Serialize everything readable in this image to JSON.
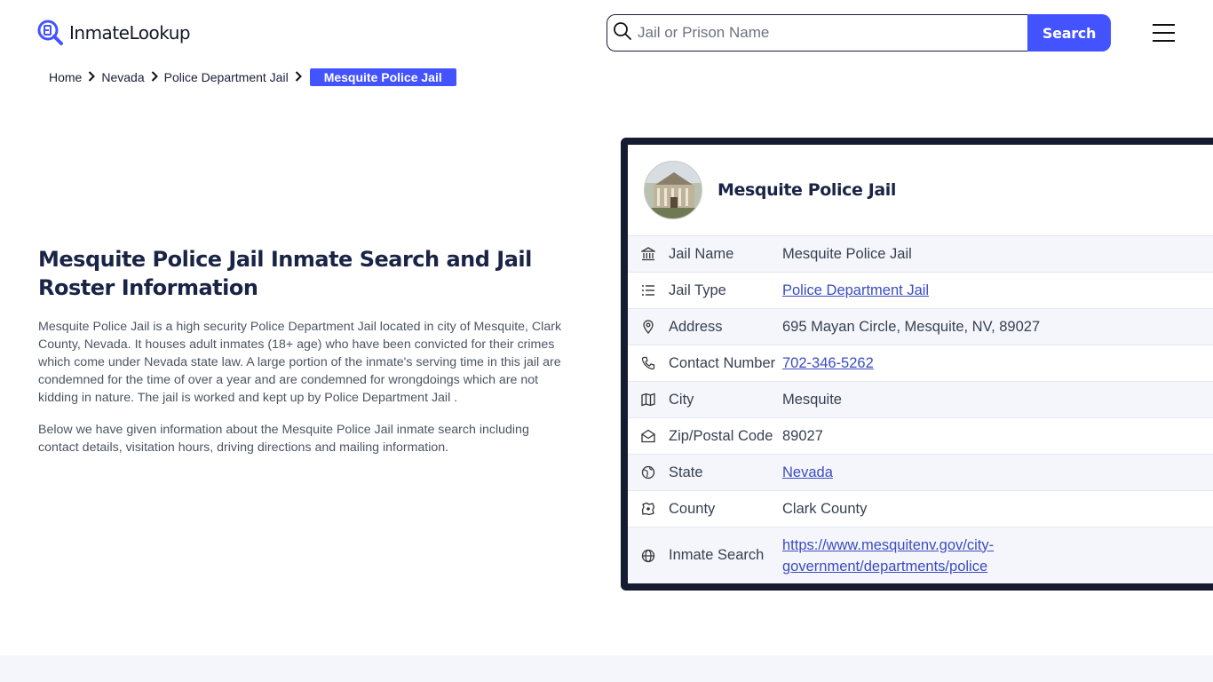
{
  "header": {
    "logo_text": "InmateLookup",
    "search_placeholder": "Jail or Prison Name",
    "search_button": "Search"
  },
  "breadcrumb": {
    "items": [
      "Home",
      "Nevada",
      "Police Department Jail"
    ],
    "active": "Mesquite Police Jail"
  },
  "intro": {
    "title": "Mesquite Police Jail Inmate Search and Jail Roster Information",
    "paragraph1": "Mesquite Police Jail is a high security Police Department Jail located in city of Mesquite, Clark County, Nevada. It houses adult inmates (18+ age) who have been convicted for their crimes which come under Nevada state law. A large portion of the inmate's serving time in this jail are condemned for the time of over a year and are condemned for wrongdoings which are not kidding in nature. The jail is worked and kept up by Police Department Jail .",
    "paragraph2": "Below we have given information about the Mesquite Police Jail inmate search including contact details, visitation hours, driving directions and mailing information."
  },
  "card": {
    "title": "Mesquite Police Jail",
    "rows": [
      {
        "icon": "building-icon",
        "label": "Jail Name",
        "value": "Mesquite Police Jail",
        "link": false
      },
      {
        "icon": "list-icon",
        "label": "Jail Type",
        "value": "Police Department Jail",
        "link": true
      },
      {
        "icon": "map-pin-icon",
        "label": "Address",
        "value": "695 Mayan Circle, Mesquite, NV, 89027",
        "link": false
      },
      {
        "icon": "phone-icon",
        "label": "Contact Number",
        "value": "702-346-5262",
        "link": true
      },
      {
        "icon": "map-icon",
        "label": "City",
        "value": "Mesquite",
        "link": false
      },
      {
        "icon": "mail-icon",
        "label": "Zip/Postal Code",
        "value": "89027",
        "link": false
      },
      {
        "icon": "globe-icon",
        "label": "State",
        "value": "Nevada",
        "link": true
      },
      {
        "icon": "county-icon",
        "label": "County",
        "value": "Clark County",
        "link": false
      },
      {
        "icon": "globe-icon",
        "label": "Inmate Search",
        "value": "https://www.mesquitenv.gov/city-government/departments/police",
        "value_line1": "https://www.mesquitenv.gov/city-",
        "value_line2": "government/departments/police",
        "link": true
      }
    ]
  },
  "colors": {
    "accent": "#4353ff",
    "card_border": "#151b30",
    "link": "#3b4cc0"
  }
}
